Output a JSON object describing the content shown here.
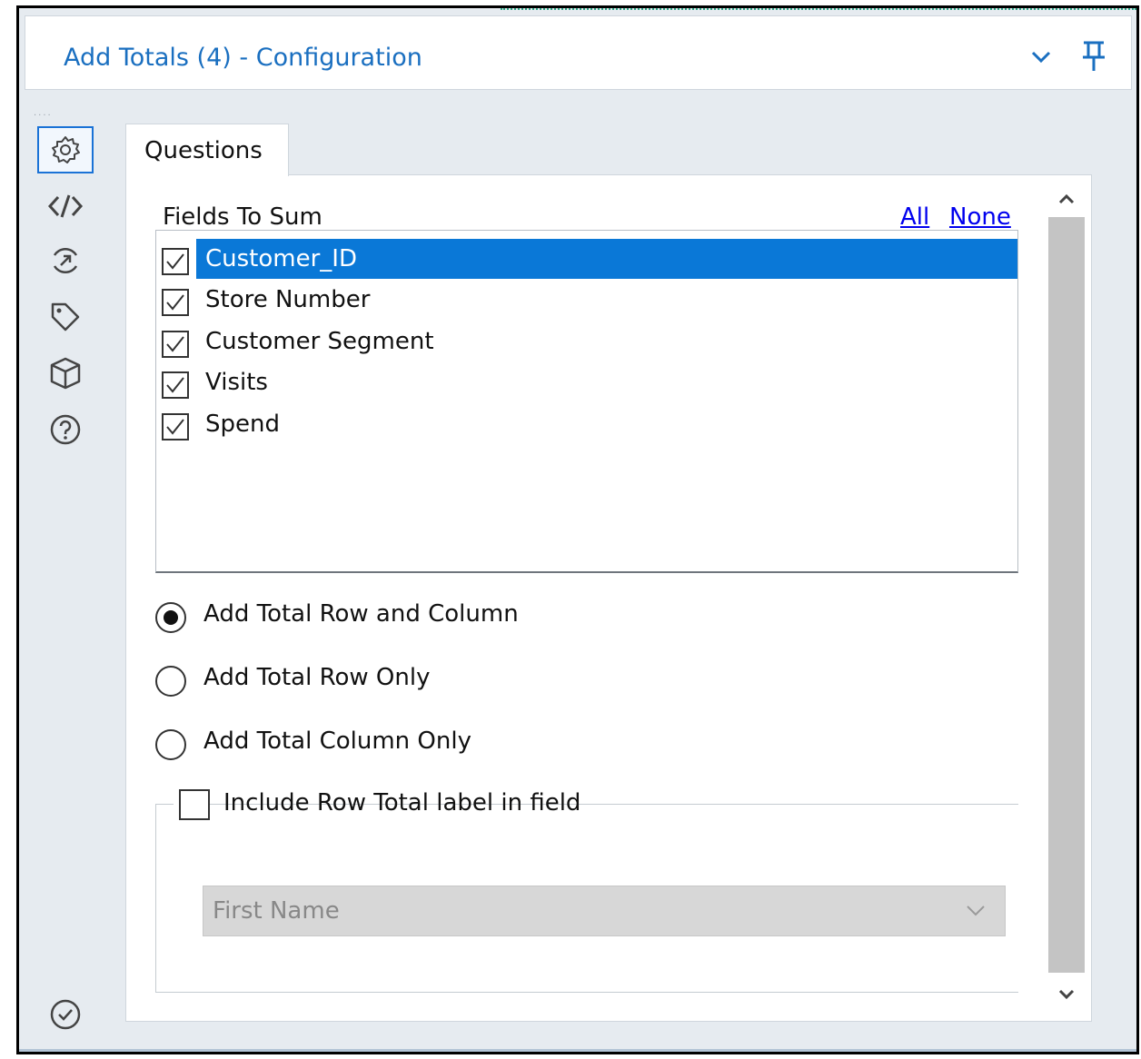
{
  "window": {
    "title": "Add Totals (4) - Configuration",
    "icons": [
      "chevron-down-icon",
      "pin-icon"
    ]
  },
  "rail": {
    "items": [
      {
        "icon": "gear-icon",
        "active": true
      },
      {
        "icon": "code-icon",
        "active": false
      },
      {
        "icon": "annotation-icon",
        "active": false
      },
      {
        "icon": "tag-icon",
        "active": false
      },
      {
        "icon": "cube-icon",
        "active": false
      },
      {
        "icon": "help-icon",
        "active": false
      }
    ],
    "bottom_icon": "check-circle-icon"
  },
  "tabs": [
    {
      "label": "Questions",
      "active": true
    }
  ],
  "fields": {
    "label": "Fields To Sum",
    "all_link": "All",
    "none_link": "None",
    "items": [
      {
        "label": "Customer_ID",
        "checked": true,
        "selected": true
      },
      {
        "label": "Store Number",
        "checked": true,
        "selected": false
      },
      {
        "label": "Customer Segment",
        "checked": true,
        "selected": false
      },
      {
        "label": "Visits",
        "checked": true,
        "selected": false
      },
      {
        "label": "Spend",
        "checked": true,
        "selected": false
      }
    ]
  },
  "options": [
    {
      "label": "Add Total Row and Column",
      "selected": true
    },
    {
      "label": "Add Total Row Only",
      "selected": false
    },
    {
      "label": "Add Total Column Only",
      "selected": false
    }
  ],
  "row_total": {
    "label": "Include Row Total label in field",
    "checked": false,
    "field_value": "First Name"
  },
  "colors": {
    "accent": "#1a6fc0",
    "selection": "#0a78d7",
    "link": "#0000ee"
  }
}
